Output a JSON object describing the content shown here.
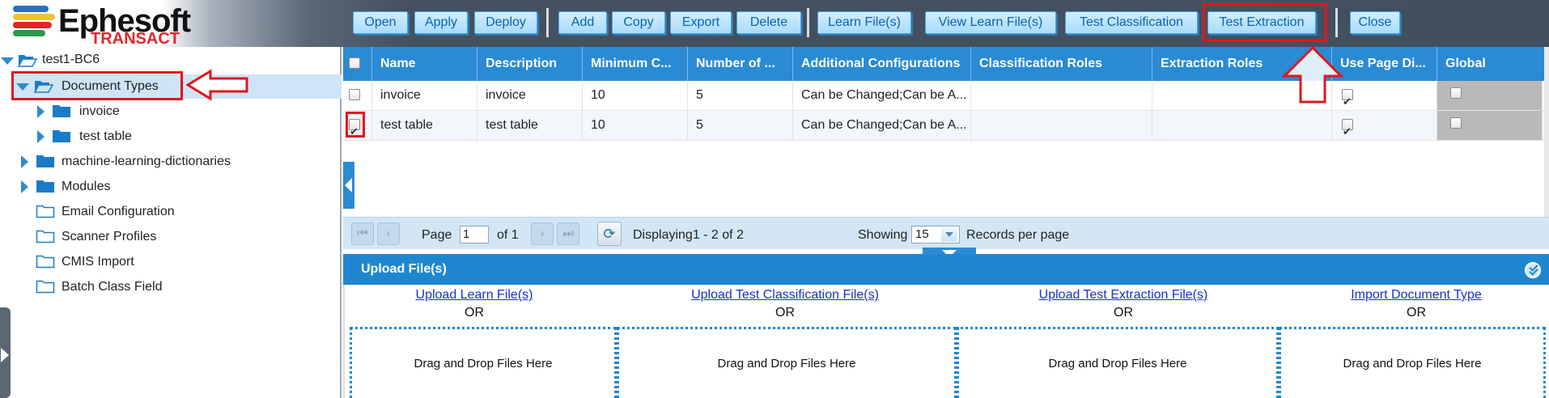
{
  "logo": {
    "name": "Ephesoft",
    "subtitle": "TRANSACT",
    "bar_colors": [
      "#2d6fc4",
      "#f2c230",
      "#e2262a",
      "#2a9a4a"
    ]
  },
  "toolbar": {
    "open": "Open",
    "apply": "Apply",
    "deploy": "Deploy",
    "add": "Add",
    "copy": "Copy",
    "export": "Export",
    "delete": "Delete",
    "learn_files": "Learn File(s)",
    "view_learn_files": "View Learn File(s)",
    "test_classification": "Test Classification",
    "test_extraction": "Test Extraction",
    "close": "Close"
  },
  "tree": {
    "root": "test1-BC6",
    "document_types": "Document Types",
    "invoice": "invoice",
    "test_table": "test table",
    "ml_dictionaries": "machine-learning-dictionaries",
    "modules": "Modules",
    "email_configuration": "Email Configuration",
    "scanner_profiles": "Scanner Profiles",
    "cmis_import": "CMIS Import",
    "batch_class_field": "Batch Class Field"
  },
  "grid": {
    "columns": [
      "Name",
      "Description",
      "Minimum C...",
      "Number of ...",
      "Additional Configurations",
      "Classification Roles",
      "Extraction Roles",
      "Use Page Di...",
      "Global"
    ],
    "rows": [
      {
        "name": "invoice",
        "description": "invoice",
        "min_conf": "10",
        "number": "5",
        "additional": "Can be Changed;Can be A...",
        "classification_roles": "",
        "extraction_roles": "",
        "selected": false,
        "use_page_di": true,
        "global": false
      },
      {
        "name": "test table",
        "description": "test table",
        "min_conf": "10",
        "number": "5",
        "additional": "Can be Changed;Can be A...",
        "classification_roles": "",
        "extraction_roles": "",
        "selected": true,
        "use_page_di": true,
        "global": false
      }
    ]
  },
  "pager": {
    "page_label": "Page",
    "page_value": "1",
    "of_label": "of 1",
    "displaying": "Displaying1 - 2 of 2",
    "showing": "Showing",
    "per_page_value": "15",
    "records_label": "Records per page"
  },
  "upload": {
    "title": "Upload File(s)",
    "or": "OR",
    "learn_link": "Upload Learn File(s)",
    "classification_link": "Upload Test Classification File(s)",
    "extraction_link": "Upload Test Extraction File(s)",
    "import_link": "Import Document Type",
    "drop_text": "Drag and Drop Files Here"
  },
  "colors": {
    "accent_blue": "#2a8ad4",
    "highlight_red": "#e0161e",
    "header_dark": "#424f5f"
  }
}
